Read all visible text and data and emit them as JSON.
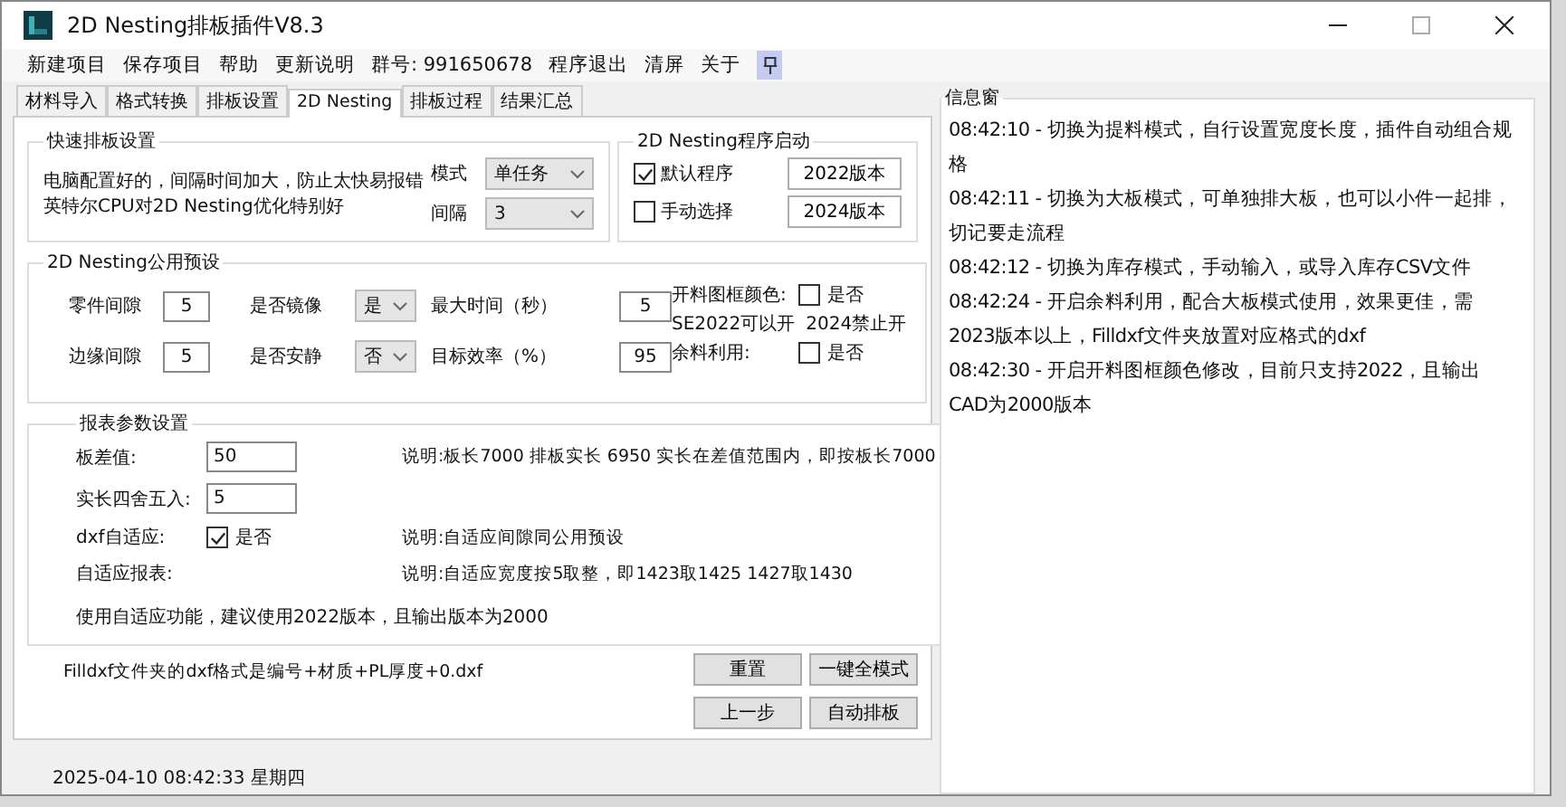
{
  "window": {
    "title": "2D Nesting排板插件V8.3"
  },
  "menu": [
    {
      "label": "新建项目"
    },
    {
      "label": "保存项目"
    },
    {
      "label": "帮助"
    },
    {
      "label": "更新说明"
    },
    {
      "label": "群号: 991650678"
    },
    {
      "label": "程序退出"
    },
    {
      "label": "清屏"
    },
    {
      "label": "关于"
    }
  ],
  "pin": {
    "on": true
  },
  "tabs": [
    {
      "label": "材料导入",
      "selected": false
    },
    {
      "label": "格式转换",
      "selected": false
    },
    {
      "label": "排板设置",
      "selected": false
    },
    {
      "label": "2D Nesting",
      "selected": true
    },
    {
      "label": "排板过程",
      "selected": false
    },
    {
      "label": "结果汇总",
      "selected": false
    }
  ],
  "quick": {
    "title": "快速排板设置",
    "notes": [
      "电脑配置好的，间隔时间加大，防止太快易报错",
      "英特尔CPU对2D Nesting优化特别好"
    ],
    "fields": [
      {
        "label": "模式",
        "value": "单任务"
      },
      {
        "label": "间隔",
        "value": "3"
      }
    ]
  },
  "launch": {
    "title": "2D Nesting程序启动",
    "options": [
      {
        "label": "默认程序",
        "checked": true,
        "button": "2022版本"
      },
      {
        "label": "手动选择",
        "checked": false,
        "button": "2024版本"
      }
    ]
  },
  "common": {
    "title": "2D Nesting公用预设",
    "rows": [
      {
        "gap_label": "零件间隙",
        "gap": "5",
        "toggle_label": "是否镜像",
        "toggle": "是",
        "num_label": "最大时间（秒）",
        "num": "5"
      },
      {
        "gap_label": "边缘间隙",
        "gap": "5",
        "toggle_label": "是否安静",
        "toggle": "否",
        "num_label": "目标效率（%）",
        "num": "95"
      }
    ],
    "frame_color": {
      "label": "开料图框颜色:",
      "option": "是否",
      "checked": false
    },
    "notes": [
      "SE2022可以开",
      "2024禁止开"
    ],
    "remnant": {
      "label": "余料利用:",
      "option": "是否",
      "checked": false
    }
  },
  "report": {
    "title": "报表参数设置",
    "rows": [
      {
        "kind": "input",
        "label": "板差值:",
        "value": "50",
        "note": "说明:板长7000 排板实长 6950  实长在差值范围内，即按板长7000"
      },
      {
        "kind": "input",
        "label": "实长四舍五入:",
        "value": "5"
      },
      {
        "kind": "check",
        "label": "dxf自适应:",
        "option": "是否",
        "checked": true,
        "note": "说明:自适应间隙同公用预设"
      },
      {
        "kind": "text",
        "label": "自适应报表:",
        "note": "说明:自适应宽度按5取整，即1423取1425 1427取1430"
      }
    ],
    "tip": "使用自适应功能，建议使用2022版本，且输出版本为2000"
  },
  "footer_note": "Filldxf文件夹的dxf格式是编号+材质+PL厚度+0.dxf",
  "buttons": [
    {
      "label": "重置"
    },
    {
      "label": "一键全模式"
    },
    {
      "label": "上一步"
    },
    {
      "label": "自动排板"
    }
  ],
  "status": "2025-04-10 08:42:33 星期四",
  "info": {
    "title": "信息窗",
    "lines": [
      "08:42:10 - 切换为提料模式，自行设置宽度长度，插件自动组合规格",
      "08:42:11 - 切换为大板模式，可单独排大板，也可以小件一起排，切记要走流程",
      "08:42:12 - 切换为库存模式，手动输入，或导入库存CSV文件",
      "08:42:24 - 开启余料利用，配合大板模式使用，效果更佳，需2023版本以上，Filldxf文件夹放置对应格式的dxf",
      "08:42:30 - 开启开料图框颜色修改，目前只支持2022，且输出CAD为2000版本"
    ]
  }
}
